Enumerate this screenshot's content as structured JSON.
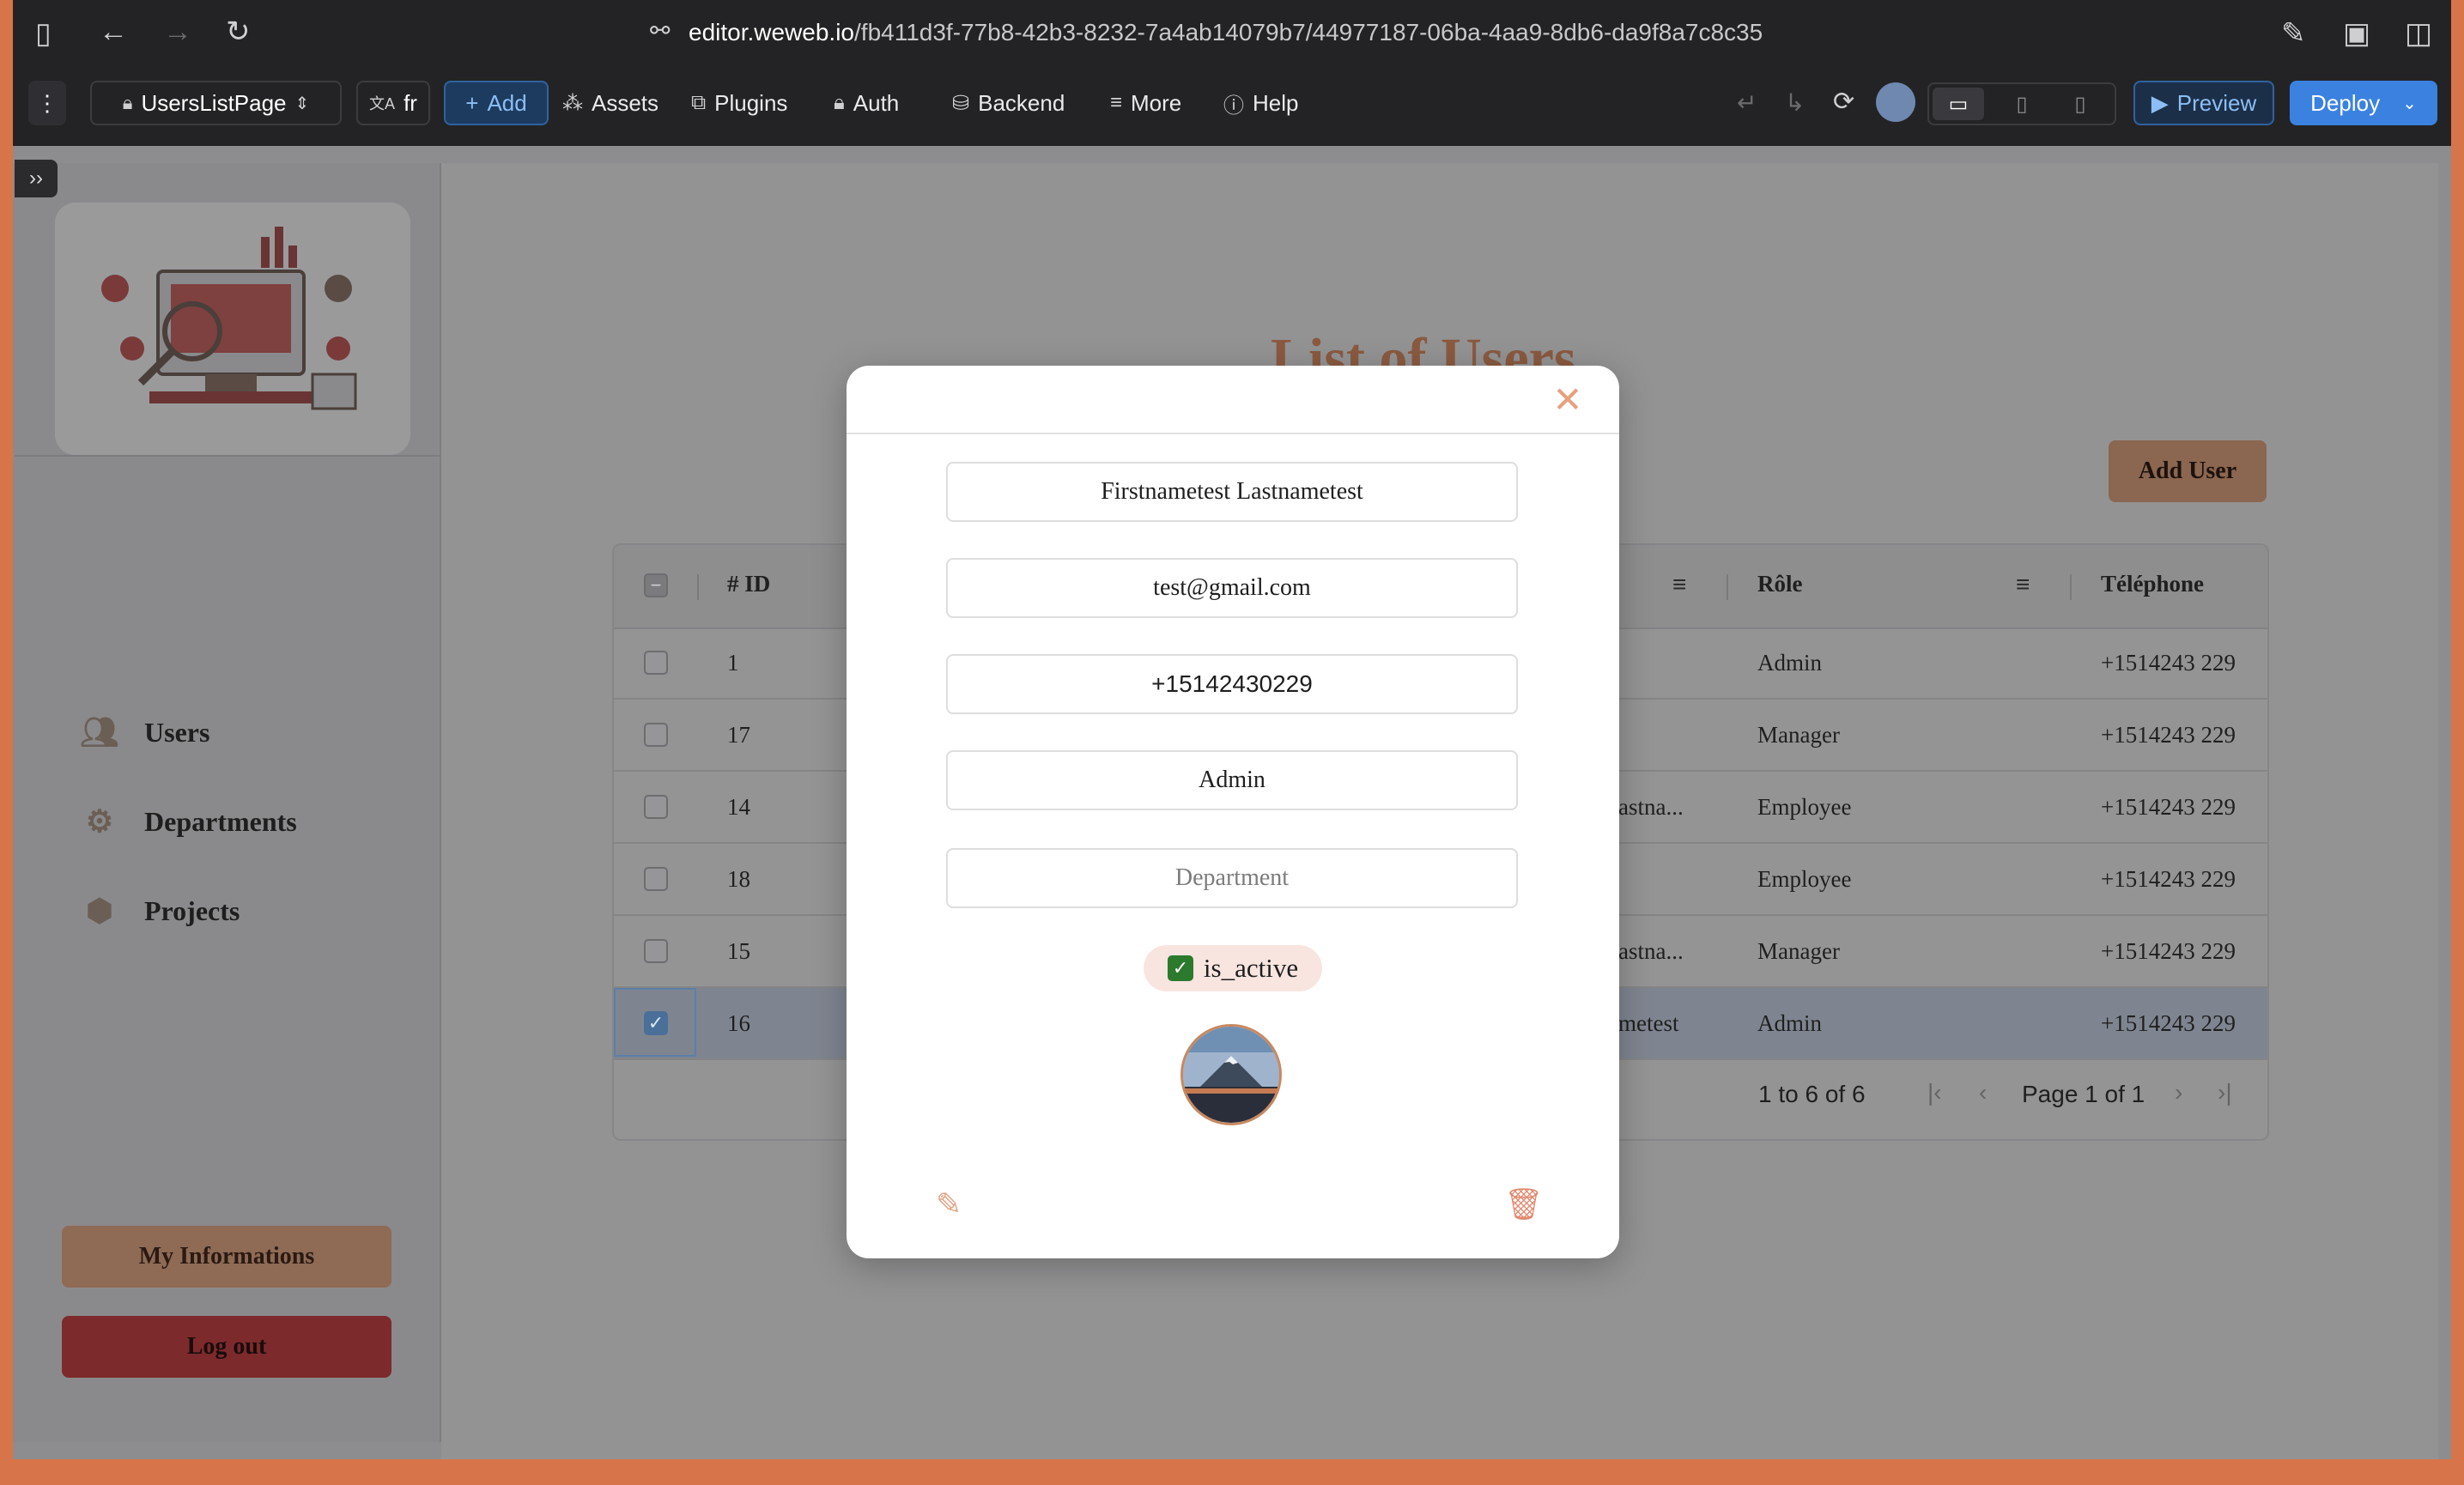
{
  "browser": {
    "url_domain": "editor.weweb.io",
    "url_path": "/fb411d3f-77b8-42b3-8232-7a4ab14079b7/44977187-06ba-4aa9-8db6-da9f8a7c8c35"
  },
  "editor_toolbar": {
    "page_selector": "UsersListPage",
    "language": "fr",
    "add_label": "Add",
    "assets_label": "Assets",
    "plugins_label": "Plugins",
    "auth_label": "Auth",
    "backend_label": "Backend",
    "more_label": "More",
    "help_label": "Help",
    "preview_label": "Preview",
    "deploy_label": "Deploy"
  },
  "sidebar": {
    "items": [
      {
        "label": "Users",
        "icon": "users-icon"
      },
      {
        "label": "Departments",
        "icon": "gears-icon"
      },
      {
        "label": "Projects",
        "icon": "boxes-icon"
      }
    ],
    "my_info_label": "My  Informations",
    "logout_label": "Log  out"
  },
  "main": {
    "title": "List  of  Users",
    "add_user_label": "Add  User",
    "table": {
      "columns": {
        "id": "#  ID",
        "role": "Rôle",
        "phone": "Téléphone"
      },
      "rows": [
        {
          "id": "1",
          "name": "",
          "role": "Admin",
          "phone": "+1514243     229",
          "selected": false
        },
        {
          "id": "17",
          "name": "",
          "role": "Manager",
          "phone": "+1514243     229",
          "selected": false
        },
        {
          "id": "14",
          "name": "astna...",
          "role": "Employee",
          "phone": "+1514243     229",
          "selected": false
        },
        {
          "id": "18",
          "name": "",
          "role": "Employee",
          "phone": "+1514243     229",
          "selected": false
        },
        {
          "id": "15",
          "name": "astna...",
          "role": "Manager",
          "phone": "+1514243     229",
          "selected": false
        },
        {
          "id": "16",
          "name": "metest",
          "role": "Admin",
          "phone": "+1514243     229",
          "selected": true
        }
      ],
      "pager": {
        "range": "1 to 6 of 6",
        "page": "Page 1 of 1"
      }
    }
  },
  "modal": {
    "full_name": "Firstnametest  Lastnametest",
    "email": "test@gmail.com",
    "phone": "+15142430229",
    "role": "Admin",
    "department_placeholder": "Department",
    "is_active_label": "is_active",
    "is_active": true,
    "colors": {
      "accent": "#e7a07f",
      "danger": "#e28a70",
      "active": "#2c7a2c"
    }
  }
}
